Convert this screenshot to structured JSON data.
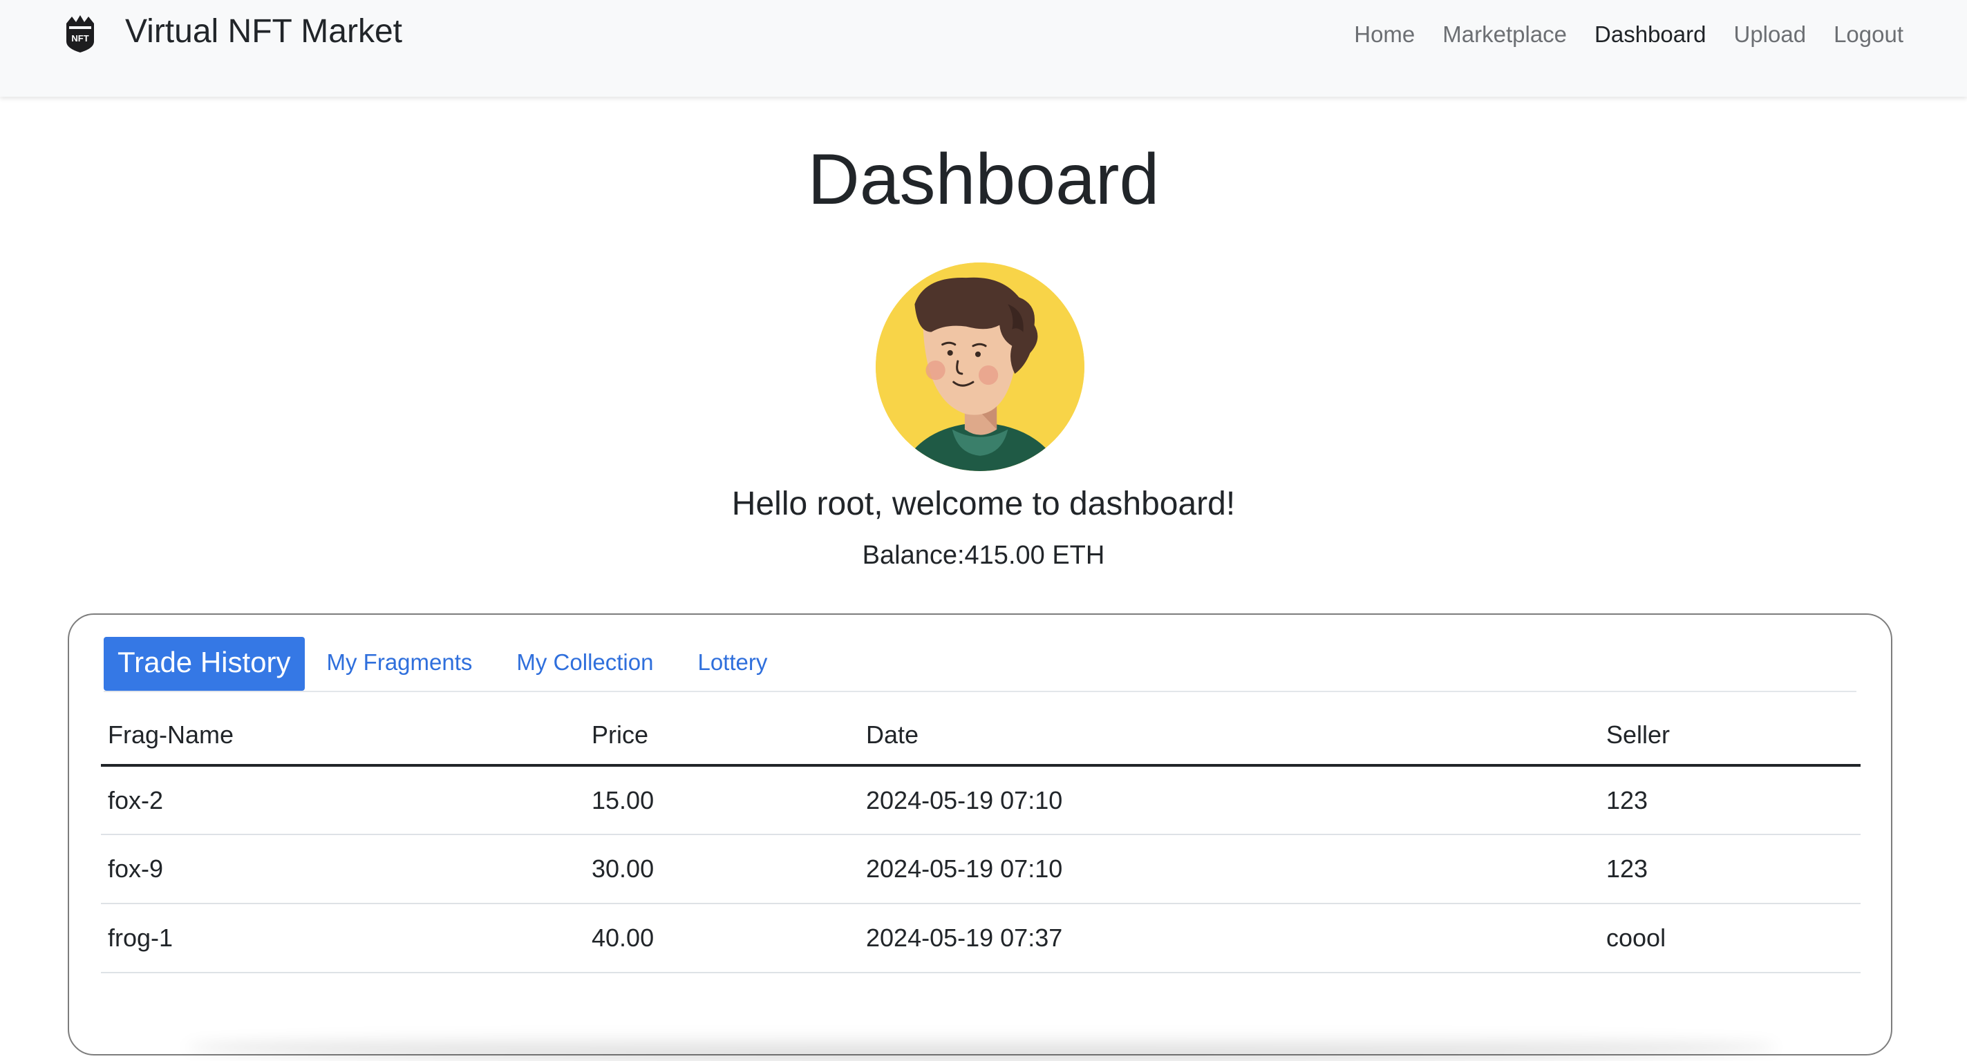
{
  "navbar": {
    "brand": "Virtual NFT Market",
    "logo_icon": "nft-shield-logo-icon",
    "links": [
      {
        "label": "Home",
        "active": false
      },
      {
        "label": "Marketplace",
        "active": false
      },
      {
        "label": "Dashboard",
        "active": true
      },
      {
        "label": "Upload",
        "active": false
      },
      {
        "label": "Logout",
        "active": false
      }
    ]
  },
  "header": {
    "title": "Dashboard",
    "avatar_icon": "user-avatar",
    "greeting": "Hello root, welcome to dashboard!",
    "balance": "Balance:415.00 ETH"
  },
  "tabs": [
    {
      "label": "Trade History",
      "active": true
    },
    {
      "label": "My Fragments",
      "active": false
    },
    {
      "label": "My Collection",
      "active": false
    },
    {
      "label": "Lottery",
      "active": false
    }
  ],
  "table": {
    "headers": [
      "Frag-Name",
      "Price",
      "Date",
      "Seller"
    ],
    "rows": [
      [
        "fox-2",
        "15.00",
        "2024-05-19 07:10",
        "123"
      ],
      [
        "fox-9",
        "30.00",
        "2024-05-19 07:10",
        "123"
      ],
      [
        "frog-1",
        "40.00",
        "2024-05-19 07:37",
        "coool"
      ]
    ]
  },
  "colors": {
    "accent": "#3578e5",
    "link": "#2f6fdc",
    "avatar_bg": "#f8d448",
    "navbar_bg": "#f8f9fa"
  }
}
